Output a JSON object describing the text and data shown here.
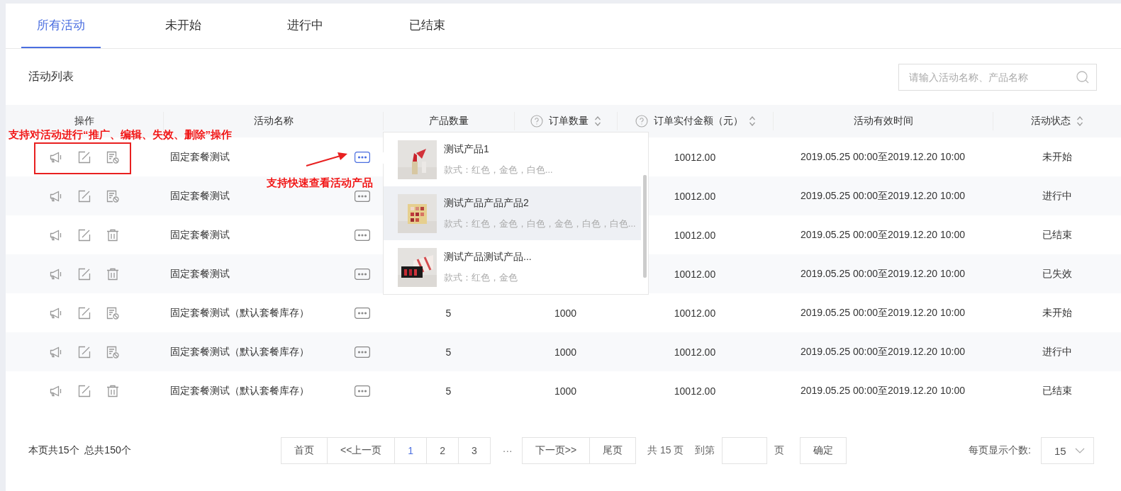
{
  "tabs": [
    {
      "label": "所有活动",
      "selected": true
    },
    {
      "label": "未开始",
      "selected": false
    },
    {
      "label": "进行中",
      "selected": false
    },
    {
      "label": "已结束",
      "selected": false
    }
  ],
  "list_title": "活动列表",
  "search": {
    "placeholder": "请输入活动名称、产品名称"
  },
  "table": {
    "columns": [
      {
        "label": "操作",
        "help": false,
        "sortable": false
      },
      {
        "label": "活动名称",
        "help": false,
        "sortable": false
      },
      {
        "label": "产品数量",
        "help": false,
        "sortable": false
      },
      {
        "label": "订单数量",
        "help": true,
        "sortable": true
      },
      {
        "label": "订单实付金额（元）",
        "help": true,
        "sortable": true
      },
      {
        "label": "活动有效时间",
        "help": false,
        "sortable": false
      },
      {
        "label": "活动状态",
        "help": false,
        "sortable": true
      }
    ],
    "rows": [
      {
        "actions": [
          {
            "kind": "megaphone"
          },
          {
            "kind": "edit"
          },
          {
            "kind": "disable"
          }
        ],
        "name": "固定套餐测试",
        "preview_open": true,
        "amount": "10012.00",
        "period": "2019.05.25 00:00至2019.12.20 10:00",
        "status": "未开始"
      },
      {
        "actions": [
          {
            "kind": "megaphone"
          },
          {
            "kind": "edit"
          },
          {
            "kind": "disable"
          }
        ],
        "name": "固定套餐测试",
        "preview_open": false,
        "amount": "10012.00",
        "period": "2019.05.25 00:00至2019.12.20 10:00",
        "status": "进行中"
      },
      {
        "actions": [
          {
            "kind": "megaphone"
          },
          {
            "kind": "edit"
          },
          {
            "kind": "delete"
          }
        ],
        "name": "固定套餐测试",
        "preview_open": false,
        "amount": "10012.00",
        "period": "2019.05.25 00:00至2019.12.20 10:00",
        "status": "已结束"
      },
      {
        "actions": [
          {
            "kind": "megaphone"
          },
          {
            "kind": "edit"
          },
          {
            "kind": "delete"
          }
        ],
        "name": "固定套餐测试",
        "preview_open": false,
        "amount": "10012.00",
        "period": "2019.05.25 00:00至2019.12.20 10:00",
        "status": "已失效"
      },
      {
        "actions": [
          {
            "kind": "megaphone"
          },
          {
            "kind": "edit"
          },
          {
            "kind": "disable"
          }
        ],
        "name": "固定套餐测试（默认套餐库存）",
        "preview_open": false,
        "product_count": "5",
        "order_count": "1000",
        "amount": "10012.00",
        "period": "2019.05.25 00:00至2019.12.20 10:00",
        "status": "未开始"
      },
      {
        "actions": [
          {
            "kind": "megaphone"
          },
          {
            "kind": "edit"
          },
          {
            "kind": "disable"
          }
        ],
        "name": "固定套餐测试（默认套餐库存）",
        "preview_open": false,
        "product_count": "5",
        "order_count": "1000",
        "amount": "10012.00",
        "period": "2019.05.25 00:00至2019.12.20 10:00",
        "status": "进行中"
      },
      {
        "actions": [
          {
            "kind": "megaphone"
          },
          {
            "kind": "edit"
          },
          {
            "kind": "delete"
          }
        ],
        "name": "固定套餐测试（默认套餐库存）",
        "preview_open": false,
        "product_count": "5",
        "order_count": "1000",
        "amount": "10012.00",
        "period": "2019.05.25 00:00至2019.12.20 10:00",
        "status": "已结束"
      }
    ]
  },
  "product_popover": {
    "items": [
      {
        "kind": "picture",
        "name": "测试产品1",
        "variants": "款式：红色，金色，白色...",
        "highlighted": false
      },
      {
        "kind": "picture",
        "name": "测试产品产品产品2",
        "variants": "款式：红色，金色，白色，金色，白色，白色...",
        "highlighted": true
      },
      {
        "kind": "picture",
        "name": "测试产品测试产品...",
        "variants": "款式：红色，金色",
        "highlighted": false
      }
    ]
  },
  "annotations": {
    "actions_note": "支持对活动进行“推广、编辑、失效、删除”操作",
    "preview_note": "支持快速查看活动产品"
  },
  "pagination": {
    "summary": "本页共15个  总共150个",
    "buttons": [
      {
        "label": "首页",
        "kind": "nav"
      },
      {
        "label": "<<上一页",
        "kind": "nav"
      },
      {
        "label": "1",
        "kind": "page",
        "selected": true
      },
      {
        "label": "2",
        "kind": "page",
        "selected": false
      },
      {
        "label": "3",
        "kind": "page",
        "selected": false
      },
      {
        "label": "···",
        "kind": "gap"
      },
      {
        "label": "下一页>>",
        "kind": "nav"
      },
      {
        "label": "尾页",
        "kind": "nav"
      }
    ],
    "total_pages": "共 15 页",
    "goto_label": "到第",
    "goto_suffix": "页",
    "confirm": "确定",
    "page_size_label": "每页显示个数:",
    "page_size": "15"
  }
}
